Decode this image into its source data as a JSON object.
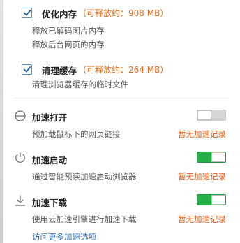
{
  "colors": {
    "accent": "#e86a16",
    "link": "#2f6db5",
    "toggle_on": "#27b04a"
  },
  "memory": {
    "title": "优化内存",
    "amount": "（可释放约：908 MB）",
    "desc1": "释放已解码图片内存",
    "desc2": "释放后台网页的内存",
    "checked": true
  },
  "cache": {
    "title": "清理缓存",
    "amount": "（可释放约：264 MB）",
    "desc1": "清理浏览器缓存的临时文件",
    "checked": true
  },
  "accelerators": [
    {
      "icon": "power-off-icon",
      "title": "加速打开",
      "desc": "预加载鼠标下的网页链接",
      "record": "暂无加速记录",
      "enabled": false
    },
    {
      "icon": "power-icon",
      "title": "加速启动",
      "desc": "通过智能预读加速启动浏览器",
      "record": "暂无加速记录",
      "enabled": true
    },
    {
      "icon": "download-icon",
      "title": "加速下载",
      "desc": "使用云加速引擎进行加速下载",
      "record": "暂无加速记录",
      "enabled": true
    }
  ],
  "more_link": "访问更多加速选项"
}
